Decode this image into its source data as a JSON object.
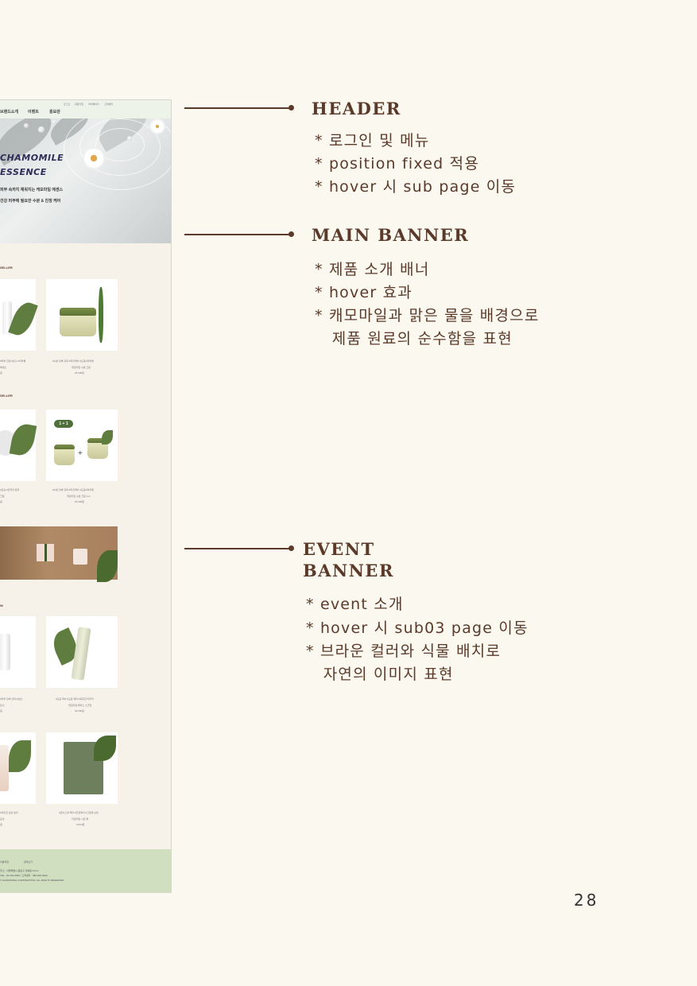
{
  "mockup": {
    "util_links": [
      "로그인",
      "회원가입",
      "마이페이지",
      "고객센터"
    ],
    "nav": [
      "브랜드소개",
      "이벤트",
      "홍보관"
    ],
    "banner": {
      "title_line1": "CHAMOMILE",
      "title_line2": "ESSENCE",
      "sub1": "피부 속까지 채워지는 캐모마일 에센스",
      "sub2": "건강 피부에 필요한 수분 & 진정 케어"
    },
    "section1_label": "SELLER",
    "section2_label": "SELLER",
    "section3_label": "W",
    "promo_badge": "1 + 1",
    "products": [
      {
        "name": "#수분 장벽 강화 #피지케어 #모공&피부결",
        "desc": "캐모마일 수분 크림",
        "price": "25,000원"
      },
      {
        "name": "#수분 장벽 강화 #피지케어 #모공&피부결",
        "desc": "캐모마일 수분 크림 1+1",
        "price": "25,000원"
      },
      {
        "name": "#모공 케어 #모공 케어 #촉촉한 마무리",
        "desc": "캐모마일 페이스 스크럽",
        "price": "20,000원"
      },
      {
        "name": "#모이스쳐 케어 #진정케어 #고영양 보습",
        "desc": "카모마일 시트 팩",
        "price": "5,000원"
      }
    ],
    "left_captions": [
      {
        "name": "#피부 진정 #흡수 #피부결",
        "desc": "에센스",
        "price": "원"
      },
      {
        "name": "#모공 #트러블 완화",
        "desc": "크림",
        "price": "원"
      },
      {
        "name": "#피부 장벽 강화 #보습",
        "desc": "토너",
        "price": "원"
      },
      {
        "name": "#촉촉한 보습 효과",
        "desc": "로션",
        "price": "원"
      }
    ],
    "footer_links": [
      "이용약관",
      "찾아오기"
    ],
    "footer_lines": [
      "주소 : 서울특별시 종로구 성북동 123-1",
      "TEL : 02-000-0000 / 고객센터 : 080-000-0000",
      "© CHAMOMILE CORPORATION. ALL RIGHTS RESERVED."
    ]
  },
  "annotations": {
    "header": {
      "title": "HEADER",
      "bullets": [
        "* 로그인 및 메뉴",
        "*  position fixed 적용",
        "*  hover 시 sub page 이동"
      ]
    },
    "main_banner": {
      "title": "MAIN BANNER",
      "bullets": [
        "* 제품 소개 배너",
        "*  hover 효과",
        "* 캐모마일과 맑은 물을 배경으로",
        "   제품 원료의 순수함을 표현"
      ]
    },
    "event_banner": {
      "title_line1": "EVENT",
      "title_line2": "BANNER",
      "bullets": [
        "*  event 소개",
        "*  hover 시 sub03 page 이동",
        "* 브라운 컬러와 식물 배치로",
        "   자연의 이미지 표현"
      ]
    }
  },
  "page_number": "28",
  "colors": {
    "accent": "#5b3a2a",
    "background": "#faf8ef",
    "footer_green": "#cfdfc0",
    "header_green": "#eef3ea"
  }
}
